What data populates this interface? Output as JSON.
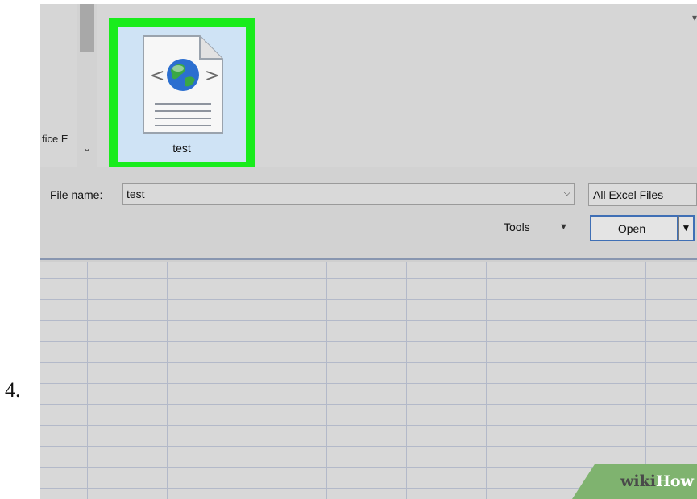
{
  "step": {
    "number": "4."
  },
  "dialog": {
    "left_pane_label": "fice E",
    "scroll_down_glyph": "⌄",
    "selected_file": {
      "name": "test",
      "icon": "html-globe-file-icon"
    },
    "filename": {
      "label": "File name:",
      "value": "test",
      "dropdown_glyph": "⌵"
    },
    "filetype": {
      "value": "All Excel Files"
    },
    "tools": {
      "label": "Tools",
      "arrow_glyph": "▼"
    },
    "open": {
      "label": "Open",
      "split_glyph": "▼"
    }
  },
  "watermark": {
    "wiki": "wiki",
    "how": "How"
  },
  "colors": {
    "highlight": "#19ec1c",
    "selection_bg": "#cfe3f5",
    "button_border": "#3f6fb5",
    "watermark": "#7fb36f"
  }
}
